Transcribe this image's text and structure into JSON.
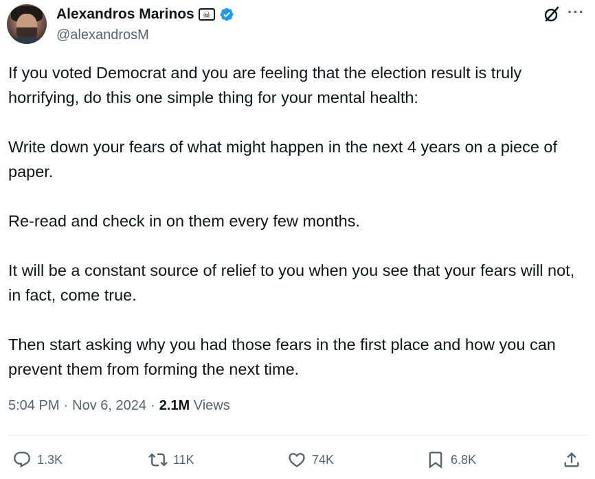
{
  "author": {
    "display_name": "Alexandros Marinos",
    "handle": "@alexandrosM",
    "badge_icon": "skull-crossbones-flag-icon",
    "verified_icon": "verified-badge-icon",
    "verified_color": "#1d9bf0"
  },
  "tweet": {
    "paragraphs": [
      "If you voted Democrat and you are feeling that the election result is truly horrifying, do this one simple thing for your mental health:",
      "Write down your fears of what might happen in the next 4 years on a piece of paper.",
      "Re-read and check in on them every few months.",
      "It will be a constant source of relief to you when you see that your fears will not, in fact, come true.",
      "Then start asking why you had those fears in the first place and how you can prevent them from forming the next time."
    ],
    "time": "5:04 PM",
    "date": "Nov 6, 2024",
    "separator": "·",
    "views_count": "2.1M",
    "views_label": "Views"
  },
  "actions": {
    "reply_count": "1.3K",
    "repost_count": "11K",
    "like_count": "74K",
    "bookmark_count": "6.8K"
  },
  "colors": {
    "text": "#0f1419",
    "secondary": "#536471",
    "accent": "#1d9bf0"
  }
}
